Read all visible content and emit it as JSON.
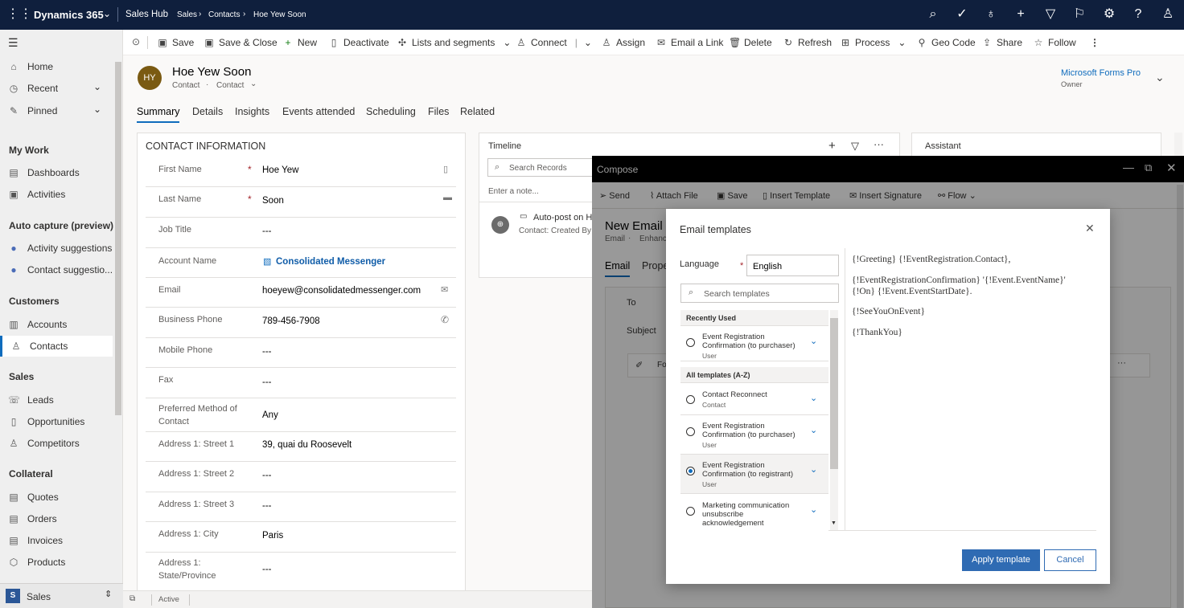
{
  "topbar": {
    "app": "Dynamics 365",
    "hub": "Sales Hub",
    "crumbs": [
      "Sales",
      "Contacts",
      "Hoe Yew Soon"
    ]
  },
  "commands": [
    "Save",
    "Save & Close",
    "New",
    "Deactivate",
    "Lists and segments",
    "Connect",
    "Assign",
    "Email a Link",
    "Delete",
    "Refresh",
    "Process",
    "Geo Code",
    "Share",
    "Follow"
  ],
  "sidebar": {
    "home": "Home",
    "recent": "Recent",
    "pinned": "Pinned",
    "mywork": "My Work",
    "dashboards": "Dashboards",
    "activities": "Activities",
    "autocap": "Auto capture (preview)",
    "actsugg": "Activity suggestions",
    "consugg": "Contact suggestio...",
    "customers": "Customers",
    "accounts": "Accounts",
    "contacts": "Contacts",
    "sales": "Sales",
    "leads": "Leads",
    "opps": "Opportunities",
    "comps": "Competitors",
    "collateral": "Collateral",
    "quotes": "Quotes",
    "orders": "Orders",
    "invoices": "Invoices",
    "products": "Products",
    "area_badge": "S",
    "area": "Sales"
  },
  "record": {
    "initials": "HY",
    "name": "Hoe Yew Soon",
    "type1": "Contact",
    "type2": "Contact",
    "owner": "Microsoft Forms Pro",
    "owner_label": "Owner"
  },
  "tabs": [
    "Summary",
    "Details",
    "Insights",
    "Events attended",
    "Scheduling",
    "Files",
    "Related"
  ],
  "contact": {
    "heading": "CONTACT INFORMATION",
    "fields": [
      {
        "label": "First Name",
        "value": "Hoe Yew"
      },
      {
        "label": "Last Name",
        "value": "Soon"
      },
      {
        "label": "Job Title",
        "value": "---"
      },
      {
        "label": "Account Name",
        "value": "Consolidated Messenger"
      },
      {
        "label": "Email",
        "value": "hoeyew@consolidatedmessenger.com"
      },
      {
        "label": "Business Phone",
        "value": "789-456-7908"
      },
      {
        "label": "Mobile Phone",
        "value": "---"
      },
      {
        "label": "Fax",
        "value": "---"
      },
      {
        "label": "Preferred Method of Contact",
        "value": "Any"
      },
      {
        "label": "Address 1: Street 1",
        "value": "39, quai du Roosevelt"
      },
      {
        "label": "Address 1: Street 2",
        "value": "---"
      },
      {
        "label": "Address 1: Street 3",
        "value": "---"
      },
      {
        "label": "Address 1: City",
        "value": "Paris"
      },
      {
        "label": "Address 1: State/Province",
        "value": "---"
      }
    ]
  },
  "timeline": {
    "title": "Timeline",
    "search": "Search Records",
    "note": "Enter a note...",
    "post": "Auto-post on H",
    "post_sub": "Contact: Created By"
  },
  "assistant": {
    "title": "Assistant"
  },
  "status": {
    "state": "Active"
  },
  "compose": {
    "title": "Compose",
    "toolbar": [
      "Send",
      "Attach File",
      "Save",
      "Insert Template",
      "Insert Signature",
      "Flow"
    ],
    "heading": "New Email",
    "sub1": "Email",
    "sub2": "Enhanc",
    "tab1": "Email",
    "tab2": "Prope",
    "to": "To",
    "subject": "Subject",
    "fo": "Fo"
  },
  "dialog": {
    "title": "Email templates",
    "language_label": "Language",
    "language_value": "English",
    "search_placeholder": "Search templates",
    "recent_header": "Recently Used",
    "all_header": "All templates (A-Z)",
    "recent": [
      {
        "name": "Event Registration Confirmation (to purchaser)",
        "sub": "User"
      }
    ],
    "all": [
      {
        "name": "Contact Reconnect",
        "sub": "Contact"
      },
      {
        "name": "Event Registration Confirmation (to purchaser)",
        "sub": "User"
      },
      {
        "name": "Event Registration Confirmation (to registrant)",
        "sub": "User"
      },
      {
        "name": "Marketing communication unsubscribe acknowledgement",
        "sub": ""
      }
    ],
    "preview": [
      "{!Greeting} {!EventRegistration.Contact},",
      "{!EventRegistrationConfirmation} '{!Event.EventName}'",
      "{!On} {!Event.EventStartDate}.",
      "{!SeeYouOnEvent}",
      "{!ThankYou}"
    ],
    "apply": "Apply template",
    "cancel": "Cancel"
  }
}
